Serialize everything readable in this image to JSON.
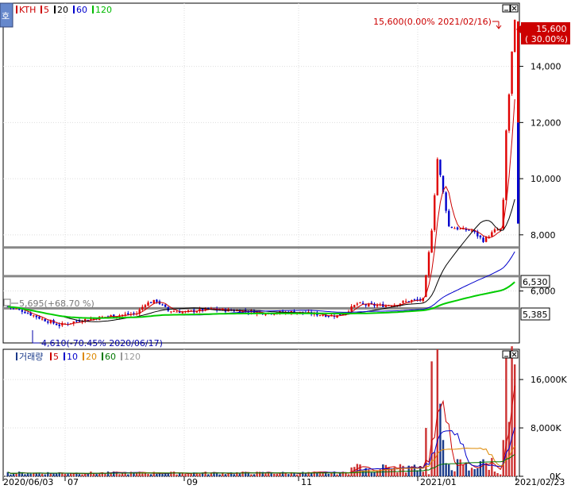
{
  "legend_price": {
    "items": [
      {
        "label": "KTH",
        "color": "#cc0000"
      },
      {
        "label": "5",
        "color": "#cc0000"
      },
      {
        "label": "20",
        "color": "#000000"
      },
      {
        "label": "60",
        "color": "#0000cc"
      },
      {
        "label": "120",
        "color": "#00bb00"
      }
    ]
  },
  "legend_volume": {
    "items": [
      {
        "label": "거래량",
        "color": "#1a3a8a"
      },
      {
        "label": "5",
        "color": "#cc0000"
      },
      {
        "label": "10",
        "color": "#0000cc"
      },
      {
        "label": "20",
        "color": "#dd8800"
      },
      {
        "label": "60",
        "color": "#007700"
      },
      {
        "label": "120",
        "color": "#999999"
      }
    ]
  },
  "side_tab": "호",
  "annotations": {
    "high": "15,600(0.00% 2021/02/16)",
    "mid": "5,695(+68.70 %)",
    "low": "4,610(-70.45% 2020/06/17)"
  },
  "current_price": {
    "price": "15,600",
    "change": "( 30.00%)"
  },
  "level_tags": [
    {
      "value": "6,530"
    },
    {
      "value": "5,385"
    }
  ],
  "chart_data": {
    "type": "candlestick",
    "title": "KTH",
    "price_axis": {
      "ticks": [
        6000,
        8000,
        10000,
        12000,
        14000
      ],
      "labels": [
        "6,000",
        "8,000",
        "10,000",
        "12,000",
        "14,000"
      ],
      "range": [
        4150,
        16250
      ]
    },
    "horizontal_levels": [
      7550,
      6530,
      5385
    ],
    "volume_axis": {
      "ticks": [
        0,
        8000,
        16000
      ],
      "labels": [
        "0K",
        "8,000K",
        "16,000K"
      ],
      "range": [
        0,
        21000
      ]
    },
    "x_labels": [
      "2020/06/03",
      "07",
      "09",
      "11",
      "2021/01",
      "2021/02/23"
    ],
    "moving_averages": [
      "5",
      "20",
      "60",
      "120"
    ]
  }
}
